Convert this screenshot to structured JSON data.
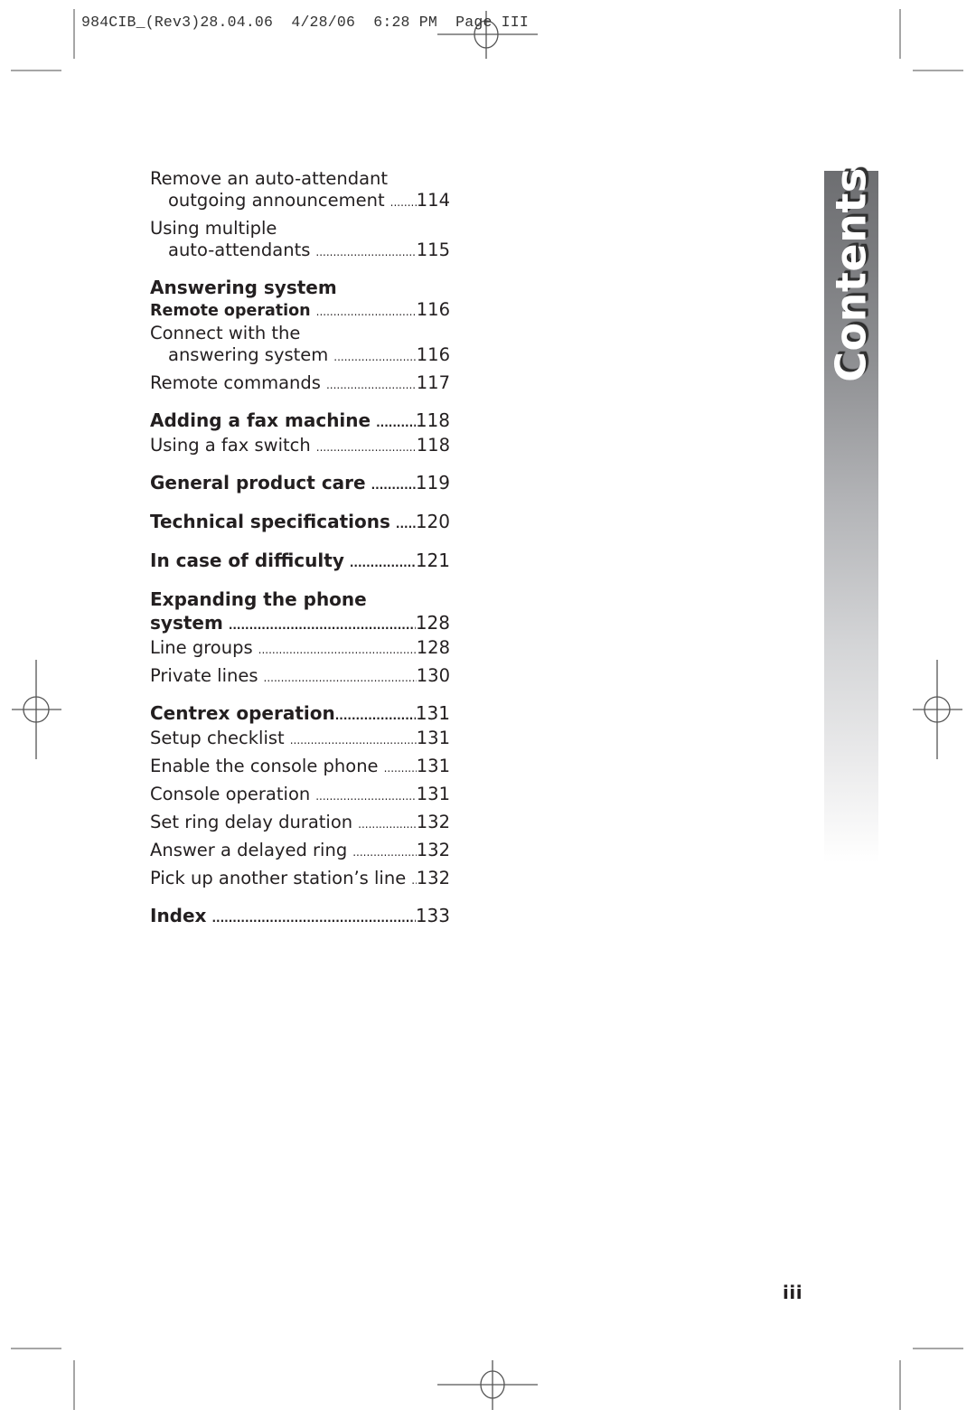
{
  "slug": {
    "text": "984CIB_(Rev3)28.04.06  4/28/06  6:28 PM  Page III"
  },
  "side_tab": {
    "label": "Contents"
  },
  "toc": {
    "entries": [
      {
        "line1": "Remove an auto-attendant",
        "label": "outgoing announcement",
        "page": "114"
      },
      {
        "line1": "Using multiple",
        "label": "auto-attendants",
        "page": "115"
      },
      {
        "heading": "Answering system"
      },
      {
        "label": "Remote operation",
        "page": "116"
      },
      {
        "line1": "Connect with the",
        "label": "answering system",
        "page": "116"
      },
      {
        "label": "Remote commands",
        "page": "117"
      },
      {
        "label": "Adding a fax machine",
        "page": "118"
      },
      {
        "label": "Using a fax switch",
        "page": "118"
      },
      {
        "label": "General product care",
        "page": "119"
      },
      {
        "label": "Technical specifications",
        "page": "120"
      },
      {
        "label": "In case of difficulty",
        "page": "121"
      },
      {
        "heading": "Expanding the phone",
        "label": "system",
        "page": "128"
      },
      {
        "label": "Line groups",
        "page": "128"
      },
      {
        "label": "Private lines",
        "page": "130"
      },
      {
        "label": "Centrex operation",
        "page": "131"
      },
      {
        "label": "Setup checklist",
        "page": "131"
      },
      {
        "label": "Enable the console phone",
        "page": "131"
      },
      {
        "label": "Console operation",
        "page": "131"
      },
      {
        "label": "Set ring delay duration",
        "page": "132"
      },
      {
        "label": "Answer a delayed ring",
        "page": "132"
      },
      {
        "label": "Pick up another station’s line",
        "page": "132"
      },
      {
        "label": "Index",
        "page": "133"
      }
    ]
  },
  "footer": {
    "page_number": "iii"
  },
  "colors": {
    "text": "#231f20",
    "tab_dark": "#6d6e71",
    "tab_light": "#ffffff"
  }
}
